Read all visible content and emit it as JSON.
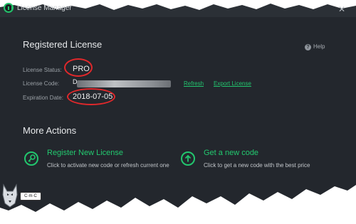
{
  "window": {
    "title": "License Manager",
    "close_icon": "close-icon",
    "logo_icon": "power-icon"
  },
  "registered": {
    "title": "Registered License",
    "help_label": "Help",
    "status_label": "License Status:",
    "status_value": "PRO",
    "code_label": "License Code:",
    "code_value": "D",
    "refresh_link": "Refresh",
    "export_link": "Export License",
    "expiration_label": "Expiration Date:",
    "expiration_value": "2018-07-05"
  },
  "more_actions": {
    "title": "More Actions",
    "register": {
      "title": "Register New License",
      "desc": "Click to activate new code or refresh current one",
      "icon": "key-icon"
    },
    "new_code": {
      "title": "Get a new code",
      "desc": "Click to get a new code with the best price",
      "icon": "arrow-up-icon"
    }
  },
  "overlay": {
    "badge_text": "C·m·C",
    "wolf_icon": "wolf-icon"
  },
  "colors": {
    "background": "#23272d",
    "accent": "#22c66e",
    "highlight": "#e0282b"
  }
}
